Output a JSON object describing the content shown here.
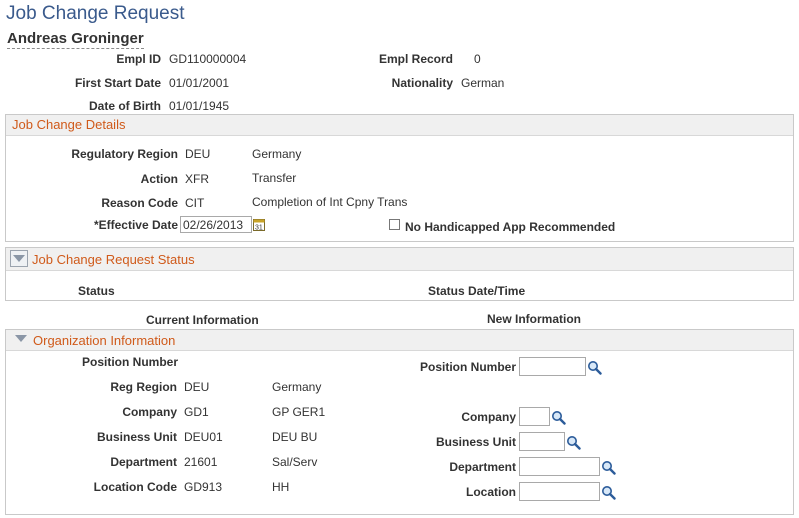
{
  "page": {
    "title": "Job Change Request"
  },
  "employee": {
    "name": "Andreas Groninger",
    "empl_id_label": "Empl ID",
    "empl_id": "GD110000004",
    "empl_record_label": "Empl Record",
    "empl_record": "0",
    "first_start_date_label": "First Start Date",
    "first_start_date": "01/01/2001",
    "nationality_label": "Nationality",
    "nationality": "German",
    "dob_label": "Date of Birth",
    "dob": "01/01/1945"
  },
  "job_change_details": {
    "title": "Job Change Details",
    "regulatory_region_label": "Regulatory Region",
    "regulatory_region_code": "DEU",
    "regulatory_region_desc": "Germany",
    "action_label": "Action",
    "action_code": "XFR",
    "action_desc": "Transfer",
    "reason_code_label": "Reason Code",
    "reason_code": "CIT",
    "reason_desc": "Completion of Int Cpny Trans",
    "effective_date_label": "*Effective Date",
    "effective_date": "02/26/2013",
    "no_handicapped_label": "No Handicapped App Recommended"
  },
  "request_status": {
    "title": "Job Change Request Status",
    "status_header": "Status",
    "status_date_header": "Status Date/Time"
  },
  "columns": {
    "current": "Current Information",
    "new": "New Information"
  },
  "organization": {
    "title": "Organization Information",
    "current": {
      "position_number_label": "Position Number",
      "reg_region_label": "Reg Region",
      "reg_region_code": "DEU",
      "reg_region_desc": "Germany",
      "company_label": "Company",
      "company_code": "GD1",
      "company_desc": "GP GER1",
      "business_unit_label": "Business Unit",
      "business_unit_code": "DEU01",
      "business_unit_desc": "DEU BU",
      "department_label": "Department",
      "department_code": "21601",
      "department_desc": "Sal/Serv",
      "location_label": "Location Code",
      "location_code": "GD913",
      "location_desc": "HH"
    },
    "new": {
      "position_number_label": "Position Number",
      "position_number_value": "",
      "company_label": "Company",
      "company_value": "",
      "business_unit_label": "Business Unit",
      "business_unit_value": "",
      "department_label": "Department",
      "department_value": "",
      "location_label": "Location",
      "location_value": ""
    }
  },
  "colors": {
    "title": "#3a5a8c",
    "section_title": "#d05a1a",
    "section_header_bg": "#f0f0f0"
  },
  "icons": {
    "lookup": "magnifier-icon",
    "calendar": "calendar-icon",
    "collapse": "triangle-down-icon"
  }
}
